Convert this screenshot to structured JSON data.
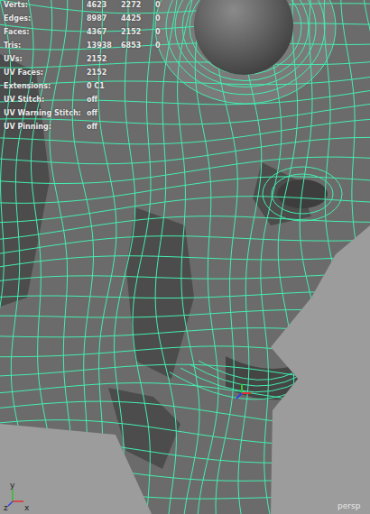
{
  "viewport": {
    "camera": "persp"
  },
  "hud": {
    "rows": [
      {
        "label": "Verts:",
        "values": [
          "4623",
          "2272",
          "0"
        ]
      },
      {
        "label": "Edges:",
        "values": [
          "8987",
          "4425",
          "0"
        ]
      },
      {
        "label": "Faces:",
        "values": [
          "4367",
          "2152",
          "0"
        ]
      },
      {
        "label": "Tris:",
        "values": [
          "13938",
          "6853",
          "0"
        ]
      },
      {
        "label": "UVs:",
        "values": [
          "2152"
        ]
      },
      {
        "label": "UV Faces:",
        "values": [
          "2152"
        ]
      },
      {
        "label": "Extensions:",
        "values": [
          "0 C1"
        ]
      },
      {
        "label": "UV Stitch:",
        "values": [
          "off"
        ]
      },
      {
        "label": "UV Warning Stitch:",
        "values": [
          "off"
        ]
      },
      {
        "label": "UV Pinning:",
        "values": [
          "off"
        ]
      }
    ]
  },
  "axis": {
    "labels": [
      "z",
      "x",
      "y"
    ]
  }
}
